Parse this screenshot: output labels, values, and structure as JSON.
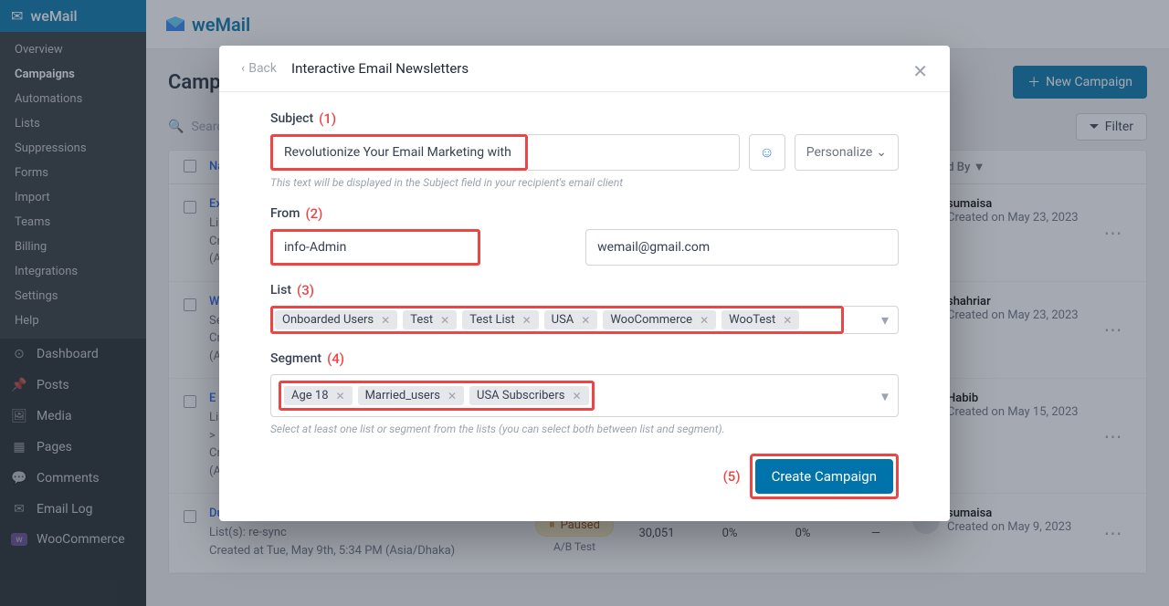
{
  "sidebar": {
    "active": "weMail",
    "submenu": [
      "Overview",
      "Campaigns",
      "Automations",
      "Lists",
      "Suppressions",
      "Forms",
      "Import",
      "Teams",
      "Billing",
      "Integrations",
      "Settings",
      "Help"
    ],
    "submenu_selected": 1,
    "items": [
      {
        "label": "Dashboard",
        "icon": "◉"
      },
      {
        "label": "Posts",
        "icon": "✎"
      },
      {
        "label": "Media",
        "icon": "▣"
      },
      {
        "label": "Pages",
        "icon": "▤"
      },
      {
        "label": "Comments",
        "icon": "✉"
      },
      {
        "label": "Email Log",
        "icon": "✉"
      },
      {
        "label": "WooCommerce",
        "icon": "w"
      }
    ]
  },
  "brand": {
    "name": "weMail"
  },
  "page": {
    "title": "Campaigns",
    "new_button": "New Campaign",
    "search_placeholder": "Search...",
    "filter": "Filter"
  },
  "table": {
    "headers": {
      "name": "Name",
      "created_by": "Created By ▼"
    },
    "rows": [
      {
        "title": "Ex",
        "lists": "List",
        "created": "Cr",
        "tz": "(Asia/Dhaka)",
        "author": "sumaisa",
        "date": "Created on May 23, 2023"
      },
      {
        "title": "W",
        "lists": "Se",
        "created": "Cr",
        "tz": "(Asia/Dhaka)",
        "author": "shahriar",
        "date": "Created on May 23, 2023"
      },
      {
        "title": "E",
        "lists": "List(s): ...",
        "created": "Cr",
        "tz": "(Asia/Dhaka)",
        "author": "Habib",
        "date": "Created on May 15, 2023"
      },
      {
        "title": "Duplicate: A/B test",
        "lists": "List(s): re-sync",
        "created": "Created at Tue, May 9th, 5:34 PM (Asia/Dhaka)",
        "tz": "",
        "status": "Paused",
        "ab": "A/B Test",
        "sent": "30,051",
        "open": "0%",
        "click": "0%",
        "rev": "—",
        "author": "sumaisa",
        "date": "Created on May 9, 2023"
      }
    ]
  },
  "modal": {
    "back": "Back",
    "title": "Interactive Email Newsletters",
    "sections": {
      "subject": {
        "label": "Subject",
        "annot": "(1)",
        "value": "Revolutionize Your Email Marketing with weMail",
        "hint": "This text will be displayed in the Subject field in your recipient's email client",
        "personalize": "Personalize"
      },
      "from": {
        "label": "From",
        "annot": "(2)",
        "name": "info-Admin",
        "email": "wemail@gmail.com"
      },
      "list": {
        "label": "List",
        "annot": "(3)",
        "tags": [
          "Onboarded Users",
          "Test",
          "Test List",
          "USA",
          "WooCommerce",
          "WooTest"
        ]
      },
      "segment": {
        "label": "Segment",
        "annot": "(4)",
        "tags": [
          "Age 18",
          "Married_users",
          "USA Subscribers"
        ],
        "hint": "Select at least one list or segment from the lists (you can select both between list and segment)."
      },
      "create": {
        "annot": "(5)",
        "label": "Create Campaign"
      }
    }
  }
}
